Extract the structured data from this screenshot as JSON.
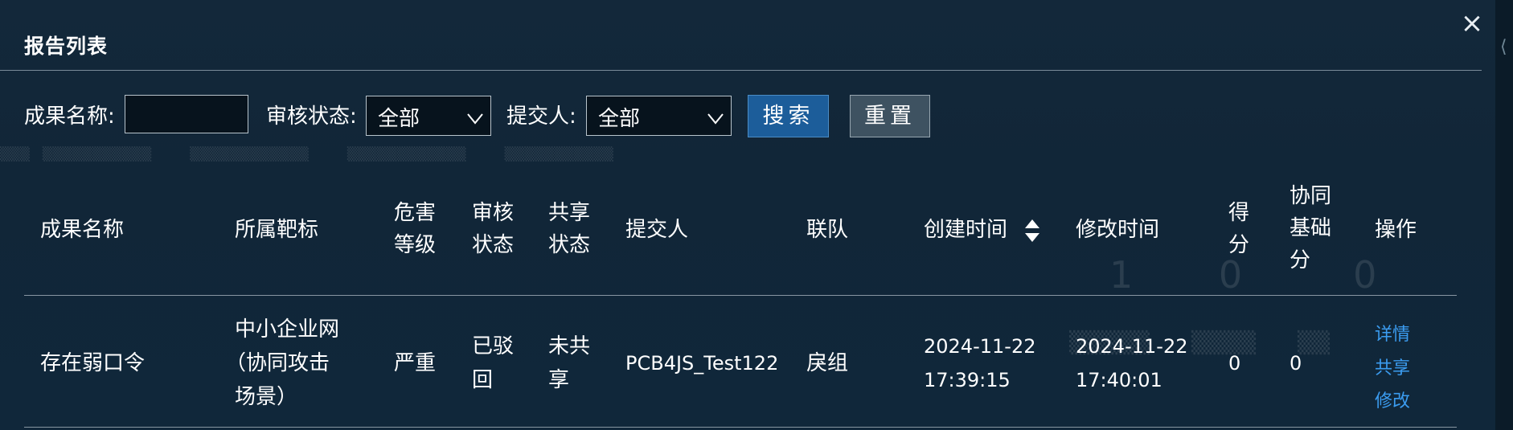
{
  "dialog": {
    "title": "报告列表",
    "close_icon": "close-icon"
  },
  "filters": {
    "result_name_label": "成果名称:",
    "result_name_value": "",
    "review_status_label": "审核状态:",
    "review_status_value": "全部",
    "submitter_label": "提交人:",
    "submitter_value": "全部",
    "search_button": "搜索",
    "reset_button": "重置"
  },
  "table": {
    "headers": {
      "name": "成果名称",
      "target": "所属靶标",
      "danger_1": "危害",
      "danger_2": "等级",
      "review_1": "审核",
      "review_2": "状态",
      "share_1": "共享",
      "share_2": "状态",
      "submitter": "提交人",
      "team": "联队",
      "created": "创建时间",
      "modified": "修改时间",
      "score_1": "得",
      "score_2": "分",
      "base_1": "协同",
      "base_2": "基础",
      "base_3": "分",
      "actions": "操作"
    },
    "rows": [
      {
        "name": "存在弱口令",
        "target_1": "中小企业网",
        "target_2": "（协同攻击",
        "target_3": "场景）",
        "danger": "严重",
        "review_1": "已驳",
        "review_2": "回",
        "share_1": "未共",
        "share_2": "享",
        "submitter": "PCB4JS_Test122",
        "team": "戾组",
        "created_date": "2024-11-22",
        "created_time": "17:39:15",
        "modified_date": "2024-11-22",
        "modified_time": "17:40:01",
        "score": "0",
        "base_score": "0",
        "action_detail": "详情",
        "action_share": "共享",
        "action_edit": "修改"
      }
    ]
  },
  "colors": {
    "background": "#112638",
    "primary_button": "#1c5d9a",
    "reset_button": "#3e5261",
    "link": "#3b9cf0"
  }
}
